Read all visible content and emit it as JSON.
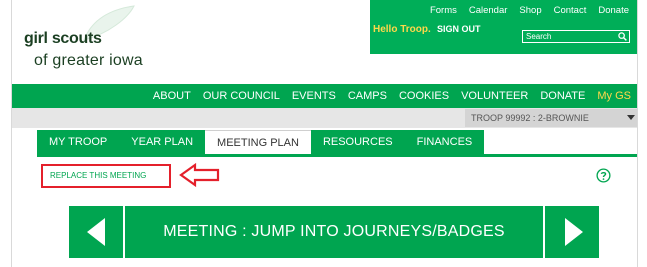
{
  "header": {
    "logo": {
      "line1": "girl scouts",
      "line2": "of greater iowa"
    },
    "utility_links": [
      "Forms",
      "Calendar",
      "Shop",
      "Contact",
      "Donate"
    ],
    "greeting": "Hello Troop.",
    "sign_out": "SIGN OUT",
    "search": {
      "placeholder": "Search",
      "icon": "search-icon"
    },
    "colors": {
      "brand_green": "#00a550",
      "accent_yellow": "#ffd84a"
    }
  },
  "main_nav": [
    "ABOUT",
    "OUR COUNCIL",
    "EVENTS",
    "CAMPS",
    "COOKIES",
    "VOLUNTEER",
    "DONATE",
    "My GS"
  ],
  "troop_select": {
    "value": "TROOP 99992 : 2-BROWNIE"
  },
  "tabs": [
    {
      "label": "MY TROOP",
      "active": false
    },
    {
      "label": "YEAR PLAN",
      "active": false
    },
    {
      "label": "MEETING PLAN",
      "active": true
    },
    {
      "label": "RESOURCES",
      "active": false
    },
    {
      "label": "FINANCES",
      "active": false
    }
  ],
  "actions": {
    "replace_meeting": "REPLACE THIS MEETING",
    "annotation_color": "#e4202b"
  },
  "meeting": {
    "title": "MEETING : JUMP INTO JOURNEYS/BADGES"
  }
}
